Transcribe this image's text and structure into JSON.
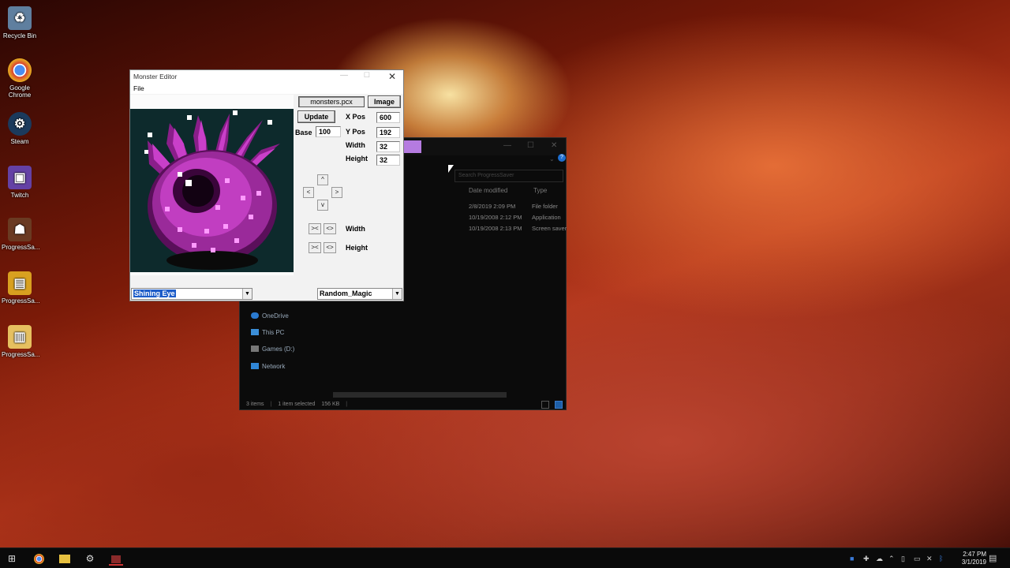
{
  "desktop": {
    "icons": [
      {
        "label": "Recycle Bin",
        "icon": "recycle-bin-icon",
        "color": "#6a8fb5"
      },
      {
        "label": "Google Chrome",
        "icon": "chrome-icon",
        "color": "#d94030"
      },
      {
        "label": "Steam",
        "icon": "steam-icon",
        "color": "#1b3a5c"
      },
      {
        "label": "Twitch",
        "icon": "twitch-icon",
        "color": "#6441a5"
      },
      {
        "label": "ProgressSa...",
        "icon": "progressquest-icon",
        "color": "#8a4a2a"
      },
      {
        "label": "ProgressSa...",
        "icon": "progressquest-folder-icon",
        "color": "#d8a020"
      },
      {
        "label": "ProgressSa...",
        "icon": "progressquest-file-icon",
        "color": "#e6b830"
      }
    ]
  },
  "explorer": {
    "search_placeholder": "Search ProgressSaver",
    "col_date": "Date modified",
    "col_type": "Type",
    "rows": [
      {
        "date": "2/8/2019 2:09 PM",
        "type": "File folder"
      },
      {
        "date": "10/19/2008 2:12 PM",
        "type": "Application"
      },
      {
        "date": "10/19/2008 2:13 PM",
        "type": "Screen saver"
      }
    ],
    "nav": [
      {
        "label": "OneDrive",
        "icon": "onedrive-icon"
      },
      {
        "label": "This PC",
        "icon": "pc-icon"
      },
      {
        "label": "Games (D:)",
        "icon": "drive-icon"
      },
      {
        "label": "Network",
        "icon": "network-icon"
      }
    ],
    "status": {
      "items": "3 items",
      "selected": "1 item selected",
      "size": "156 KB"
    }
  },
  "monster_editor": {
    "title": "Monster Editor",
    "menu_file": "File",
    "sprite_file": "monsters.pcx",
    "image_button": "Image",
    "update_button": "Update",
    "base_label": "Base",
    "base_value": "100",
    "xpos_label": "X Pos",
    "xpos_value": "600",
    "ypos_label": "Y Pos",
    "ypos_value": "192",
    "width_label": "Width",
    "width_value": "32",
    "height_label": "Height",
    "height_value": "32",
    "arrow_up": "^",
    "arrow_down": "v",
    "arrow_left": "<",
    "arrow_right": ">",
    "shrink_glyph": "><",
    "grow_glyph": "<>",
    "width_resize_label": "Width",
    "height_resize_label": "Height",
    "monster_selected": "Shining Eye",
    "category_selected": "Random_Magic"
  },
  "taskbar": {
    "time": "2:47 PM",
    "date": "3/1/2019"
  }
}
